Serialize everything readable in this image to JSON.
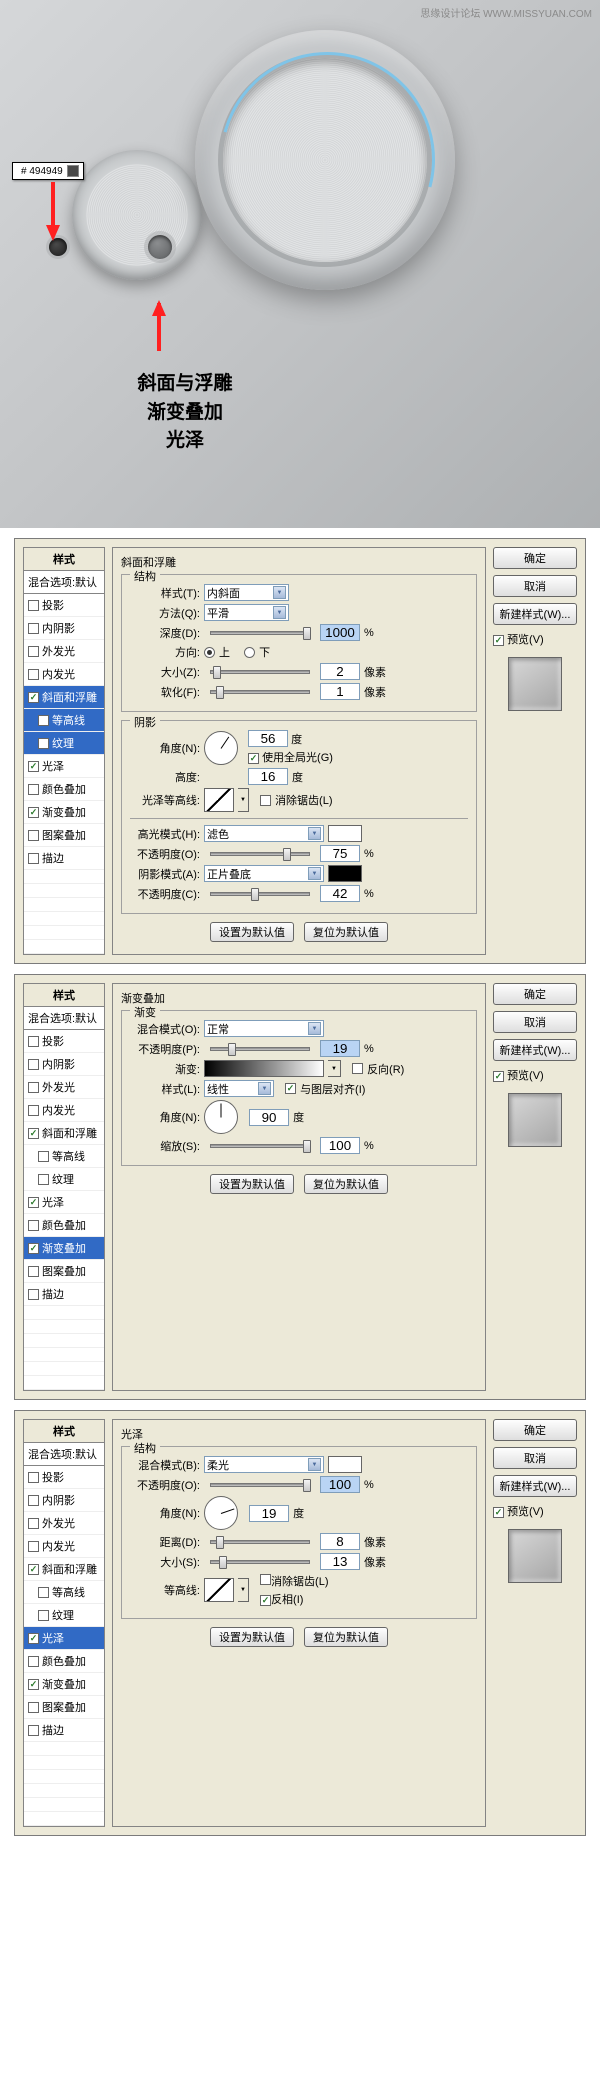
{
  "hero": {
    "watermark": "思缘设计论坛 WWW.MISSYUAN.COM",
    "color_code": "# 494949",
    "labels": [
      "斜面与浮雕",
      "渐变叠加",
      "光泽"
    ]
  },
  "common": {
    "styles_header": "样式",
    "blend_default": "混合选项:默认",
    "ok": "确定",
    "cancel": "取消",
    "new_style": "新建样式(W)...",
    "preview": "预览(V)",
    "set_default": "设置为默认值",
    "reset_default": "复位为默认值",
    "px": "像素",
    "deg": "度",
    "pct": "%"
  },
  "style_items": {
    "drop_shadow": "投影",
    "inner_shadow": "内阴影",
    "outer_glow": "外发光",
    "inner_glow": "内发光",
    "bevel": "斜面和浮雕",
    "contour": "等高线",
    "texture": "纹理",
    "satin": "光泽",
    "color_overlay": "颜色叠加",
    "gradient_overlay": "渐变叠加",
    "pattern_overlay": "图案叠加",
    "stroke": "描边"
  },
  "panel1": {
    "title": "斜面和浮雕",
    "struct": "结构",
    "style_label": "样式(T):",
    "style_val": "内斜面",
    "method_label": "方法(Q):",
    "method_val": "平滑",
    "depth_label": "深度(D):",
    "depth_val": "1000",
    "direction_label": "方向:",
    "dir_up": "上",
    "dir_down": "下",
    "size_label": "大小(Z):",
    "size_val": "2",
    "soft_label": "软化(F):",
    "soft_val": "1",
    "shadow": "阴影",
    "angle_label": "角度(N):",
    "angle_val": "56",
    "use_global": "使用全局光(G)",
    "altitude_label": "高度:",
    "altitude_val": "16",
    "gloss_contour": "光泽等高线:",
    "antialias": "消除锯齿(L)",
    "highlight_mode": "高光模式(H):",
    "highlight_val": "滤色",
    "opacity_label": "不透明度(O):",
    "opacity_val": "75",
    "shadow_mode": "阴影模式(A):",
    "shadow_val": "正片叠底",
    "opacity_label2": "不透明度(C):",
    "opacity_val2": "42"
  },
  "panel2": {
    "title": "渐变叠加",
    "grad": "渐变",
    "blend_label": "混合模式(O):",
    "blend_val": "正常",
    "opacity_label": "不透明度(P):",
    "opacity_val": "19",
    "gradient_label": "渐变:",
    "reverse": "反向(R)",
    "style_label": "样式(L):",
    "style_val": "线性",
    "align_layer": "与图层对齐(I)",
    "angle_label": "角度(N):",
    "angle_val": "90",
    "scale_label": "缩放(S):",
    "scale_val": "100"
  },
  "panel3": {
    "title": "光泽",
    "struct": "结构",
    "blend_label": "混合模式(B):",
    "blend_val": "柔光",
    "opacity_label": "不透明度(O):",
    "opacity_val": "100",
    "angle_label": "角度(N):",
    "angle_val": "19",
    "distance_label": "距离(D):",
    "distance_val": "8",
    "size_label": "大小(S):",
    "size_val": "13",
    "contour_label": "等高线:",
    "antialias": "消除锯齿(L)",
    "invert": "反相(I)"
  }
}
